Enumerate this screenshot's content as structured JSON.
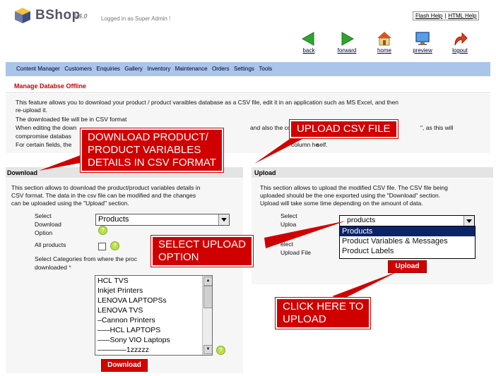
{
  "header": {
    "logo_name": "BShop",
    "logo_version": "V4.0",
    "login_text": "Logged in as Super Admin !",
    "flash_help": "Flash Help",
    "html_help": "HTML Help",
    "nav": [
      {
        "label": "back",
        "icon": "back-arrow-icon"
      },
      {
        "label": "forward",
        "icon": "forward-arrow-icon"
      },
      {
        "label": "home",
        "icon": "home-icon"
      },
      {
        "label": "preview",
        "icon": "monitor-icon"
      },
      {
        "label": "logout",
        "icon": "logout-arrow-icon"
      }
    ]
  },
  "menu": [
    "Content Manager",
    "Customers",
    "Enquiries",
    "Gallery",
    "Inventory",
    "Maintenance",
    "Orders",
    "Settings",
    "Tools"
  ],
  "page": {
    "title": "Manage Databse Offline",
    "info": [
      "This feature allows you to download your product / product varaibles database as a CSV file, edit it in an application such as MS Excel, and then",
      "re-upload it.",
      "The downloaded file will be in CSV format",
      "When editing the down",
      "compromise databas",
      "For certain fields, the"
    ],
    "info_right": [
      "and also the co",
      "\", as this will",
      "column he",
      "self."
    ]
  },
  "download": {
    "heading": "Download",
    "desc": [
      "This section allows to download the product/product variables details in",
      "CSV format. The data in the csv file can be modified and the changes",
      "can be uploaded using the \"Upload\" section."
    ],
    "select_label": [
      "Select",
      "Download",
      "Option"
    ],
    "select_value": "Products",
    "all_products_label": "All products",
    "categories_label": "Select Categories from where the proc",
    "categories_label_2": "downloaded",
    "required_mark": "*",
    "categories": [
      "HCL TVS",
      "Inkjet Printers",
      "LENOVA LAPTOPSs",
      "LENOVA TVS",
      "–Cannon Printers",
      "–––HCL LAPTOPS",
      "–––Sony VIO Laptops",
      "–––––––1zzzzz"
    ],
    "button": "Download"
  },
  "upload": {
    "heading": "Upload",
    "desc": [
      "This section allows to upload the modified CSV file. The CSV file being",
      "uploaded should be the one exported using the \"Download\" section.",
      "Upload will take some time depending on the amount of data."
    ],
    "select_label": [
      "Select",
      "Uploa"
    ],
    "file_label": [
      "elect",
      "Upload File"
    ],
    "select_value": "products",
    "options": [
      "Products",
      "Product Variables & Messages",
      "Product Labels"
    ],
    "button": "Upload"
  },
  "callouts": {
    "download": [
      "DOWNLOAD PRODUCT/",
      "PRODUCT VARIABLES",
      "DETAILS IN CSV FORMAT"
    ],
    "upload_csv": "UPLOAD CSV FILE",
    "select_option": [
      "SELECT UPLOAD",
      "OPTION"
    ],
    "click_upload": [
      "CLICK HERE TO",
      "UPLOAD"
    ]
  },
  "help_icon_text": "?"
}
